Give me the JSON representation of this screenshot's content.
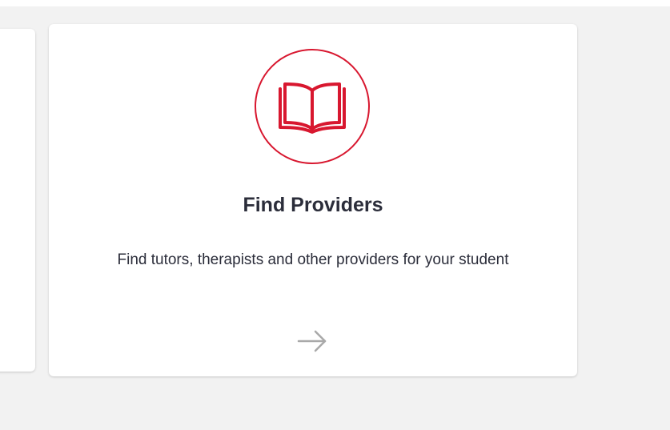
{
  "colors": {
    "accent": "#d8172f",
    "text": "#2b2d3a",
    "arrow": "#a9a9a9",
    "background": "#f2f2f2",
    "card": "#ffffff"
  },
  "card": {
    "icon": "open-book-icon",
    "title": "Find Providers",
    "description": "Find tutors, therapists and other providers for your student",
    "arrow_icon": "arrow-right-icon"
  }
}
